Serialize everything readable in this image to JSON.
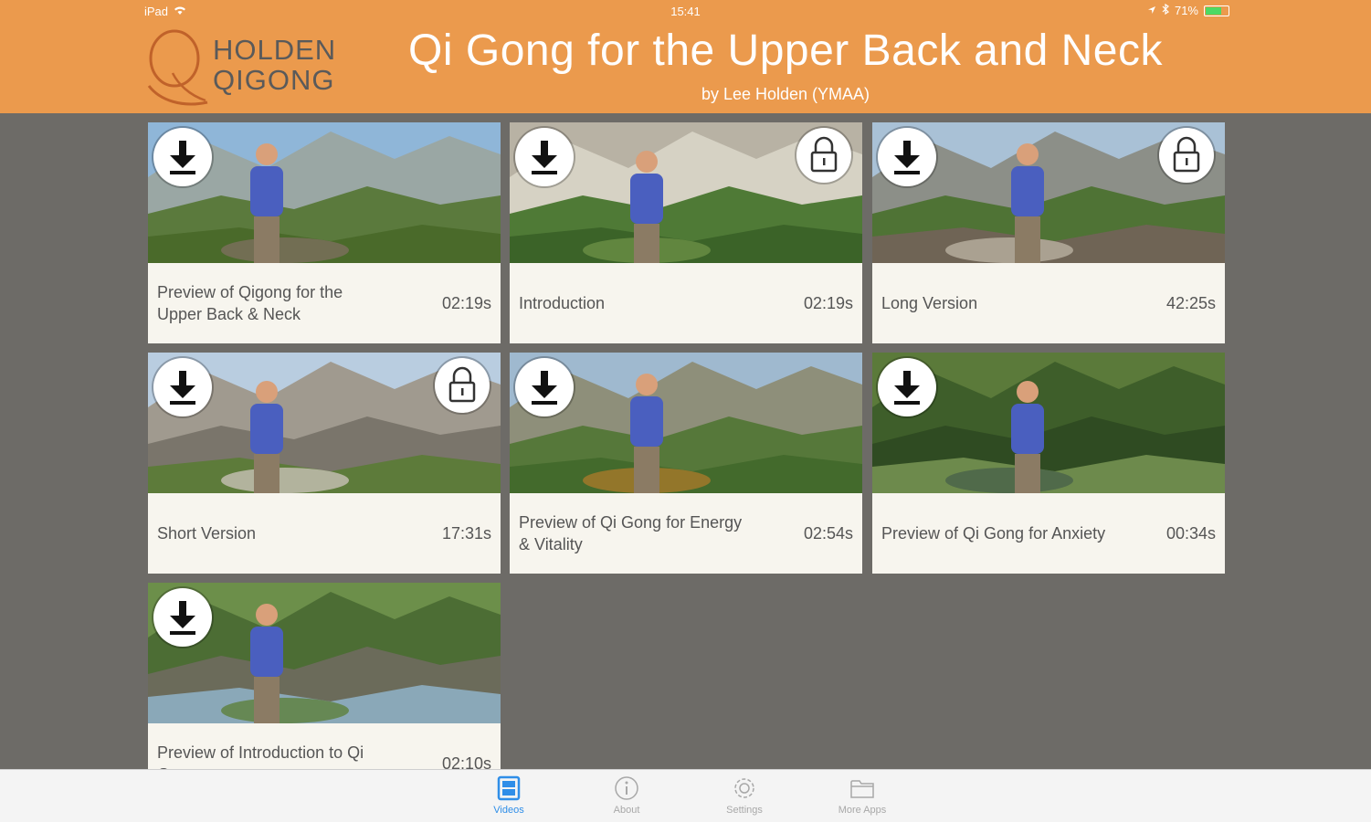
{
  "status": {
    "device": "iPad",
    "time": "15:41",
    "battery": "71%",
    "battery_level": 0.71
  },
  "header": {
    "logo_line1": "HOLDEN",
    "logo_line2": "QIGONG",
    "title": "Qi Gong for the Upper Back and Neck",
    "subtitle": "by Lee Holden (YMAA)"
  },
  "videos": [
    {
      "title": "Preview of Qigong for the Upper Back & Neck",
      "duration": "02:19s",
      "locked": false
    },
    {
      "title": "Introduction",
      "duration": "02:19s",
      "locked": true
    },
    {
      "title": "Long Version",
      "duration": "42:25s",
      "locked": true
    },
    {
      "title": "Short Version",
      "duration": "17:31s",
      "locked": true
    },
    {
      "title": "Preview of Qi Gong for Energy & Vitality",
      "duration": "02:54s",
      "locked": false
    },
    {
      "title": "Preview of Qi Gong for Anxiety",
      "duration": "00:34s",
      "locked": false
    },
    {
      "title": "Preview of Introduction to Qi Gong",
      "duration": "02:10s",
      "locked": false
    }
  ],
  "tabs": [
    {
      "label": "Videos",
      "icon": "videos-icon",
      "active": true
    },
    {
      "label": "About",
      "icon": "info-icon",
      "active": false
    },
    {
      "label": "Settings",
      "icon": "gear-icon",
      "active": false
    },
    {
      "label": "More Apps",
      "icon": "folder-icon",
      "active": false
    }
  ],
  "colors": {
    "header": "#eb9a4d",
    "background": "#6d6b67",
    "card": "#f7f5ee",
    "tab_active": "#2f8ee8"
  }
}
